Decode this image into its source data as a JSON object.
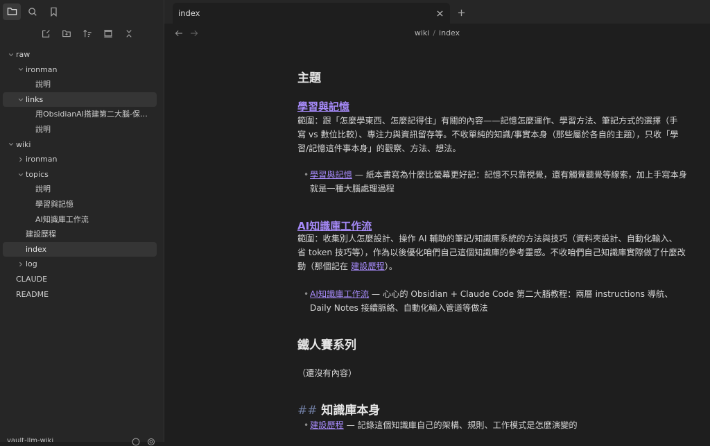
{
  "sidebar": {
    "tree": [
      {
        "label": "raw",
        "depth": 0,
        "chevron": "down"
      },
      {
        "label": "ironman",
        "depth": 1,
        "chevron": "down"
      },
      {
        "label": "說明",
        "depth": 2
      },
      {
        "label": "links",
        "depth": 1,
        "chevron": "down",
        "selected": true
      },
      {
        "label": "用ObsidianAI搭建第二大腦-保姆...",
        "depth": 2
      },
      {
        "label": "說明",
        "depth": 2
      },
      {
        "label": "wiki",
        "depth": 0,
        "chevron": "down"
      },
      {
        "label": "ironman",
        "depth": 1,
        "chevron": "right"
      },
      {
        "label": "topics",
        "depth": 1,
        "chevron": "down"
      },
      {
        "label": "說明",
        "depth": 2
      },
      {
        "label": "學習與記憶",
        "depth": 2
      },
      {
        "label": "AI知識庫工作流",
        "depth": 2
      },
      {
        "label": "建設歷程",
        "depth": 1
      },
      {
        "label": "index",
        "depth": 1,
        "selected": true
      },
      {
        "label": "log",
        "depth": 1,
        "chevron": "right"
      },
      {
        "label": "CLAUDE",
        "depth": 0
      },
      {
        "label": "README",
        "depth": 0
      }
    ],
    "vault_name": "vault-llm-wiki"
  },
  "tab": {
    "title": "index",
    "close": "×",
    "new": "+"
  },
  "breadcrumb": {
    "folder": "wiki",
    "sep": "/",
    "file": "index"
  },
  "content": {
    "h_topics": "主題",
    "s1_title": "學習與記憶",
    "s1_desc": "範圍：跟「怎麼學東西、怎麼記得住」有關的內容——記憶怎麼運作、學習方法、筆記方式的選擇（手寫 vs 數位比較）、專注力與資訊留存等。不收單純的知識/事實本身（那些屬於各自的主題），只收「學習/記憶這件事本身」的觀察、方法、想法。",
    "s1_b1_link": "學習與記憶",
    "s1_b1_text": " — 紙本書寫為什麼比螢幕更好記：記憶不只靠視覺，還有觸覺聽覺等線索，加上手寫本身就是一種大腦處理過程",
    "s2_title": "AI知識庫工作流",
    "s2_desc_a": "範圍：收集別人怎麼設計、操作 AI 輔助的筆記/知識庫系統的方法與技巧（資料夾設計、自動化輸入、省 token 技巧等），作為以後優化咱們自己這個知識庫的參考靈感。不收咱們自己知識庫實際做了什麼改動（那個記在 ",
    "s2_desc_link": "建設歷程",
    "s2_desc_b": "）。",
    "s2_b1_link": "AI知識庫工作流",
    "s2_b1_text": " — 心心的 Obsidian + Claude Code 第二大腦教程：兩層 instructions 導航、Daily Notes 接續脈絡、自動化輸入管道等做法",
    "h_ironman": "鐵人賽系列",
    "ironman_empty": "（還沒有內容）",
    "h_kb_hash": "##",
    "h_kb": "知識庫本身",
    "kb_b1_link": "建設歷程",
    "kb_b1_text": " — 記錄這個知識庫自己的架構、規則、工作模式是怎麼演變的",
    "bullet_char": "•"
  }
}
